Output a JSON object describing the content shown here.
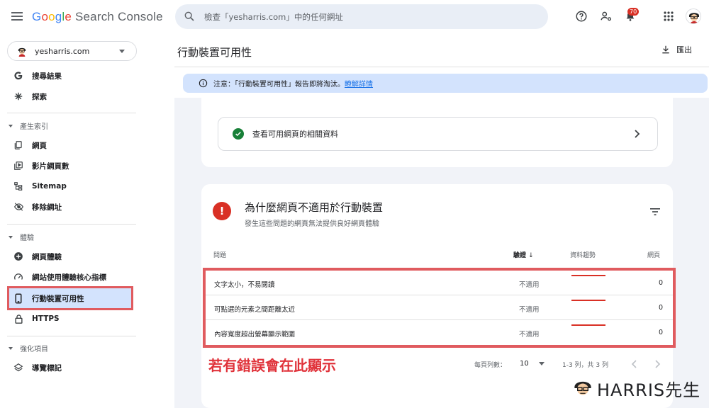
{
  "app": {
    "logo_google": [
      "G",
      "o",
      "o",
      "g",
      "l",
      "e"
    ],
    "logo_product": "Search Console"
  },
  "search": {
    "placeholder": "檢查「yesharris.com」中的任何網址"
  },
  "header_icons": [
    "help-icon",
    "settings-people-icon",
    "notifications-icon",
    "apps-grid-icon"
  ],
  "notifications": {
    "count": "70"
  },
  "property": {
    "name": "yesharris.com"
  },
  "sidebar": {
    "top_items": [
      {
        "label": "搜尋結果",
        "icon": "google-g-icon"
      },
      {
        "label": "探索",
        "icon": "asterisk-icon"
      }
    ],
    "sections": [
      {
        "title": "產生索引",
        "items": [
          {
            "label": "網頁",
            "icon": "pages-icon"
          },
          {
            "label": "影片網頁數",
            "icon": "video-pages-icon"
          },
          {
            "label": "Sitemap",
            "icon": "sitemap-icon"
          },
          {
            "label": "移除網址",
            "icon": "eye-off-icon"
          }
        ]
      },
      {
        "title": "體驗",
        "items": [
          {
            "label": "網頁體驗",
            "icon": "plus-circle-icon"
          },
          {
            "label": "網站使用體驗核心指標",
            "icon": "gauge-icon"
          },
          {
            "label": "行動裝置可用性",
            "icon": "phone-icon",
            "active": true
          },
          {
            "label": "HTTPS",
            "icon": "lock-icon"
          }
        ]
      },
      {
        "title": "強化項目",
        "items": [
          {
            "label": "導覽標記",
            "icon": "layers-icon"
          }
        ]
      }
    ]
  },
  "page": {
    "title": "行動裝置可用性",
    "export_label": "匯出",
    "notice": {
      "text": "注意：「行動裝置可用性」報告即將淘汰。",
      "link": "瞭解詳情"
    },
    "valid_link": "查看可用網頁的相關資料",
    "issues_card": {
      "title": "為什麼網頁不適用於行動裝置",
      "subtitle": "發生這些問題的網頁無法提供良好網頁體驗",
      "columns": {
        "issue": "問題",
        "validation": "驗證",
        "trend": "資料趨勢",
        "pages": "網頁"
      },
      "rows": [
        {
          "name": "文字太小，不易閱讀",
          "validation": "不適用",
          "pages": "0"
        },
        {
          "name": "可點選的元素之間距離太近",
          "validation": "不適用",
          "pages": "0"
        },
        {
          "name": "內容寬度超出螢幕顯示範圍",
          "validation": "不適用",
          "pages": "0"
        }
      ],
      "rows_per_page_label": "每頁列數：",
      "rows_per_page": "10",
      "range": "1-3 列，共 3 列"
    },
    "annotation": "若有錯誤會在此顯示"
  },
  "watermark": {
    "text": "HARRIS先生"
  },
  "colors": {
    "accent": "#1a73e8",
    "error": "#d93025",
    "success": "#188038",
    "highlight_border": "#e05b5f"
  }
}
